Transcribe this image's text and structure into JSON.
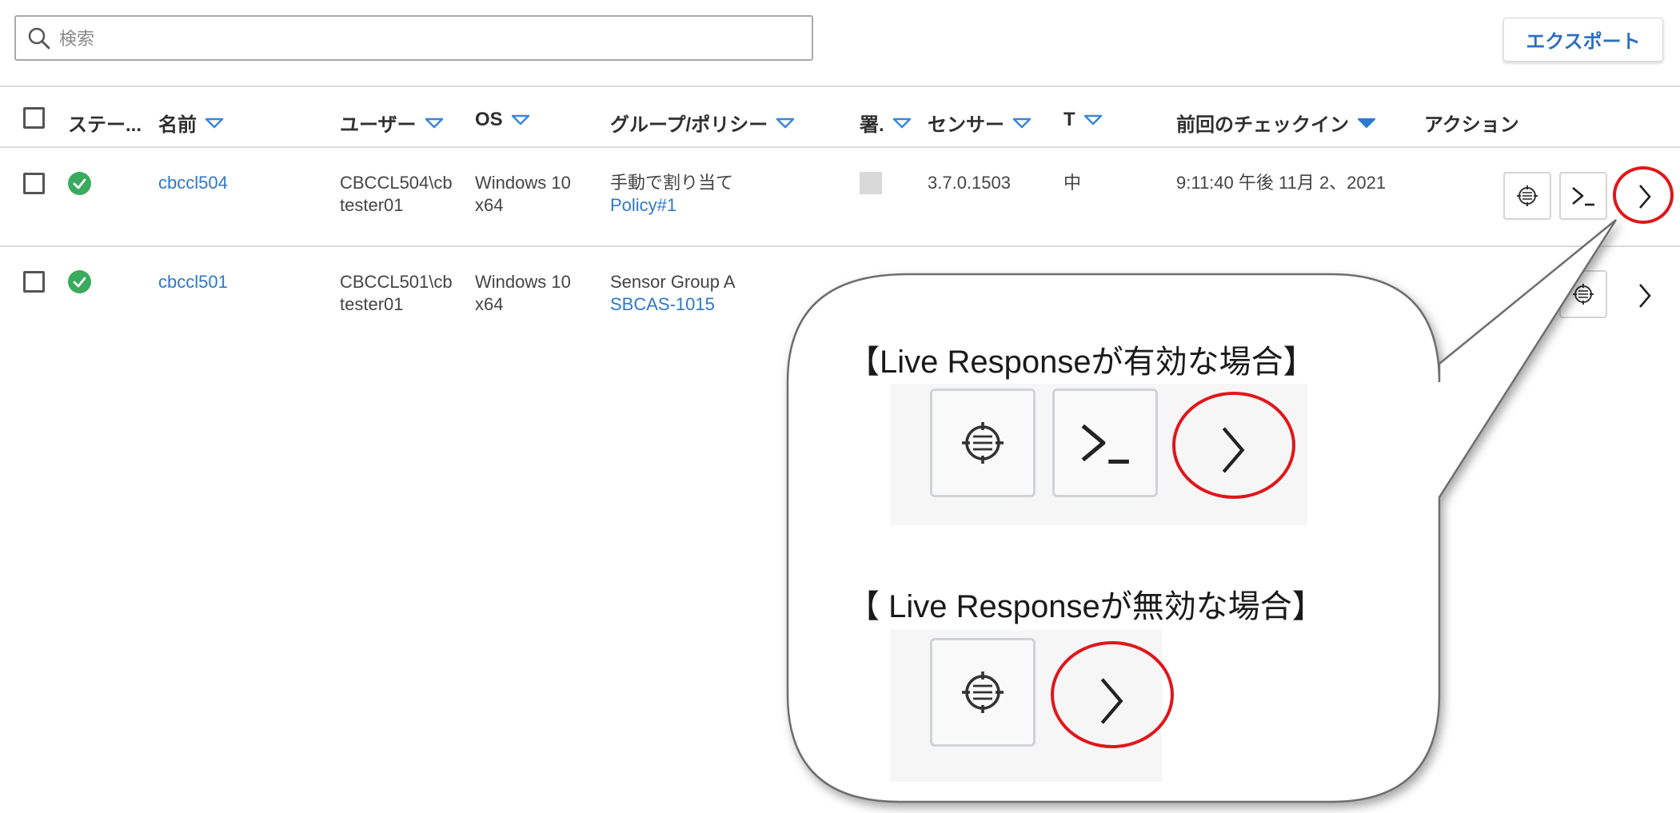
{
  "search": {
    "placeholder": "検索"
  },
  "export_label": "エクスポート",
  "headers": {
    "status": "ステー...",
    "name": "名前",
    "user": "ユーザー",
    "os": "OS",
    "group": "グループ/ポリシー",
    "signature": "署.",
    "sensor": "センサー",
    "t": "T",
    "last_checkin": "前回のチェックイン",
    "action": "アクション"
  },
  "rows": [
    {
      "name": "cbccl504",
      "user_line1": "CBCCL504\\cb",
      "user_line2": "tester01",
      "os_line1": "Windows 10",
      "os_line2": "x64",
      "group": "手動で割り当て",
      "policy": "Policy#1",
      "sensor": "3.7.0.1503",
      "t": "中",
      "last_checkin": "9:11:40 午後 11月 2、2021"
    },
    {
      "name": "cbccl501",
      "user_line1": "CBCCL501\\cb",
      "user_line2": "tester01",
      "os_line1": "Windows 10",
      "os_line2": "x64",
      "group": "Sensor Group A",
      "policy": "SBCAS-1015"
    }
  ],
  "callout": {
    "enabled_title": "【Live Responseが有効な場合】",
    "disabled_title": "【 Live Responseが無効な場合】"
  },
  "colors": {
    "link": "#2f78c7",
    "status_ok": "#3aaa5c",
    "highlight_ring": "#e0161b",
    "export_text": "#2d6fbf"
  }
}
